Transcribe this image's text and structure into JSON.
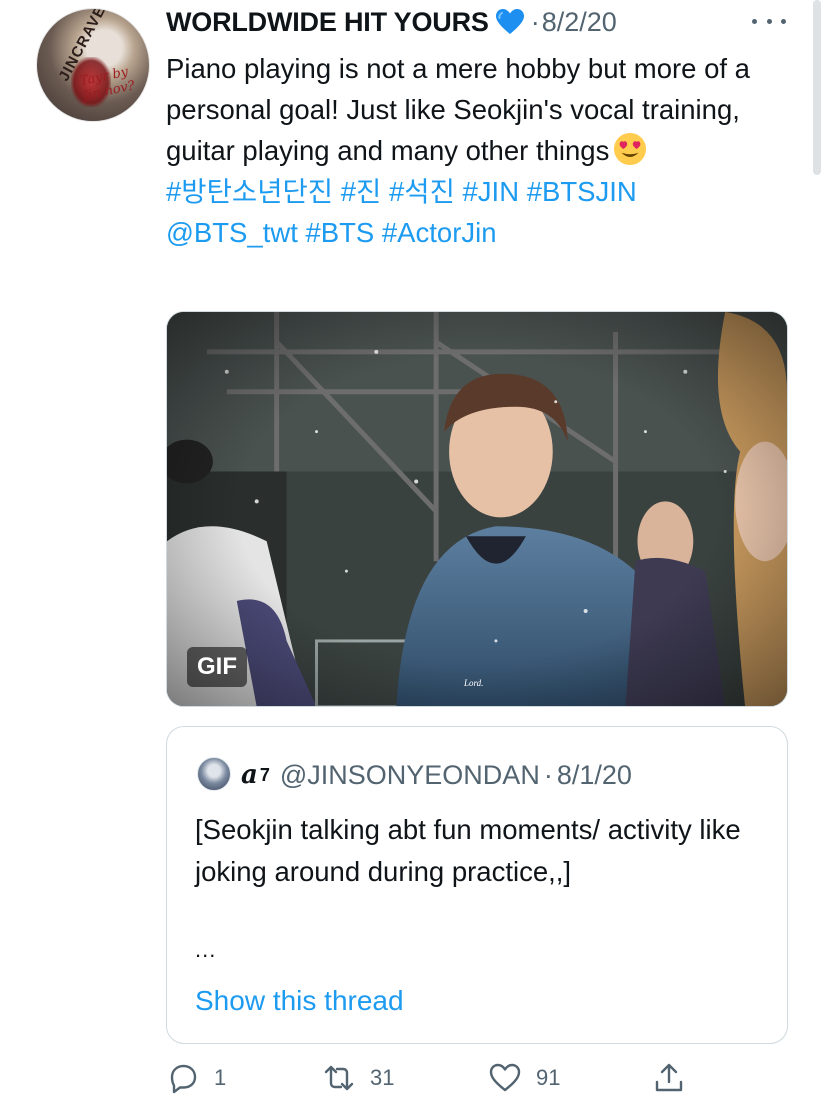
{
  "tweet": {
    "display_name": "WORLDWIDE HIT YOURS",
    "badge_icon": "blue-heart-icon",
    "separator": "·",
    "date": "8/2/20",
    "text_main": "Piano playing is not a mere hobby but more of a personal goal! Just like Seokjin's vocal training, guitar playing and many other things",
    "emoji": "heart-eyes-emoji",
    "hashtags_line1": "#방탄소년단진 #진 #석진 #JIN #BTSJIN",
    "hashtags_line2": "@BTS_twt #BTS #ActorJin",
    "avatar_text": "JINCRAVE",
    "avatar_script": "Tayr by Jin nov?"
  },
  "media": {
    "badge": "GIF",
    "watermark": "Lord."
  },
  "quote": {
    "name": "a",
    "superscript": "7",
    "handle": "@JINSONYEONDAN",
    "separator": "·",
    "date": "8/1/20",
    "text": "[Seokjin talking abt fun moments/ activity like joking around during practice,,]",
    "ellipsis": "...",
    "show_thread": "Show this thread"
  },
  "actions": {
    "reply_count": "1",
    "retweet_count": "31",
    "like_count": "91"
  },
  "colors": {
    "link": "#1d9bf0",
    "secondary": "#536471",
    "heart": "#1d9bf0"
  }
}
